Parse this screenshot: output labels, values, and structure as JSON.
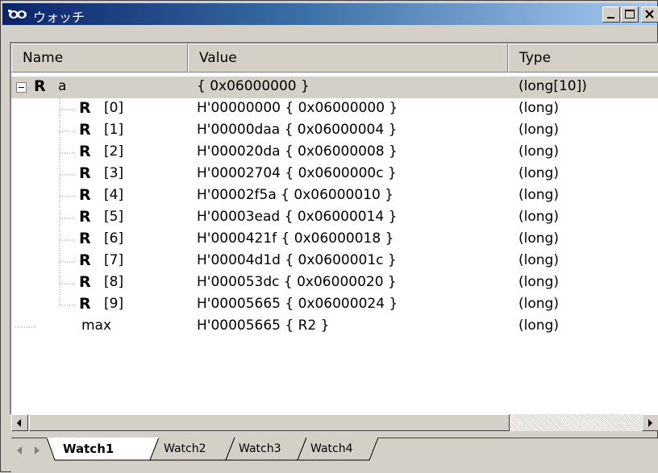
{
  "window": {
    "title": "ウォッチ",
    "min_glyph": "_",
    "title_icon": "glasses-icon"
  },
  "columns": {
    "name": "Name",
    "value": "Value",
    "type": "Type"
  },
  "rows": [
    {
      "name": "a",
      "value": "{ 0x06000000 }",
      "type": "(long[10])",
      "icon": "R"
    },
    {
      "name": "[0]",
      "value": "H'00000000 { 0x06000000 }",
      "type": "(long)",
      "icon": "R"
    },
    {
      "name": "[1]",
      "value": "H'00000daa { 0x06000004 }",
      "type": "(long)",
      "icon": "R"
    },
    {
      "name": "[2]",
      "value": "H'000020da { 0x06000008 }",
      "type": "(long)",
      "icon": "R"
    },
    {
      "name": "[3]",
      "value": "H'00002704 { 0x0600000c }",
      "type": "(long)",
      "icon": "R"
    },
    {
      "name": "[4]",
      "value": "H'00002f5a { 0x06000010 }",
      "type": "(long)",
      "icon": "R"
    },
    {
      "name": "[5]",
      "value": "H'00003ead { 0x06000014 }",
      "type": "(long)",
      "icon": "R"
    },
    {
      "name": "[6]",
      "value": "H'0000421f { 0x06000018 }",
      "type": "(long)",
      "icon": "R"
    },
    {
      "name": "[7]",
      "value": "H'00004d1d { 0x0600001c }",
      "type": "(long)",
      "icon": "R"
    },
    {
      "name": "[8]",
      "value": "H'000053dc { 0x06000020 }",
      "type": "(long)",
      "icon": "R"
    },
    {
      "name": "[9]",
      "value": "H'00005665 { 0x06000024 }",
      "type": "(long)",
      "icon": "R"
    },
    {
      "name": "max",
      "value": "H'00005665 { R2 }",
      "type": "(long)",
      "icon": ""
    }
  ],
  "tabs": [
    {
      "label": "Watch1",
      "active": true
    },
    {
      "label": "Watch2",
      "active": false
    },
    {
      "label": "Watch3",
      "active": false
    },
    {
      "label": "Watch4",
      "active": false
    }
  ],
  "colors": {
    "title_gradient_start": "#0a246a",
    "title_gradient_end": "#a6caf0",
    "face": "#d4d0c8",
    "selected_row": "#d4d0c8"
  }
}
